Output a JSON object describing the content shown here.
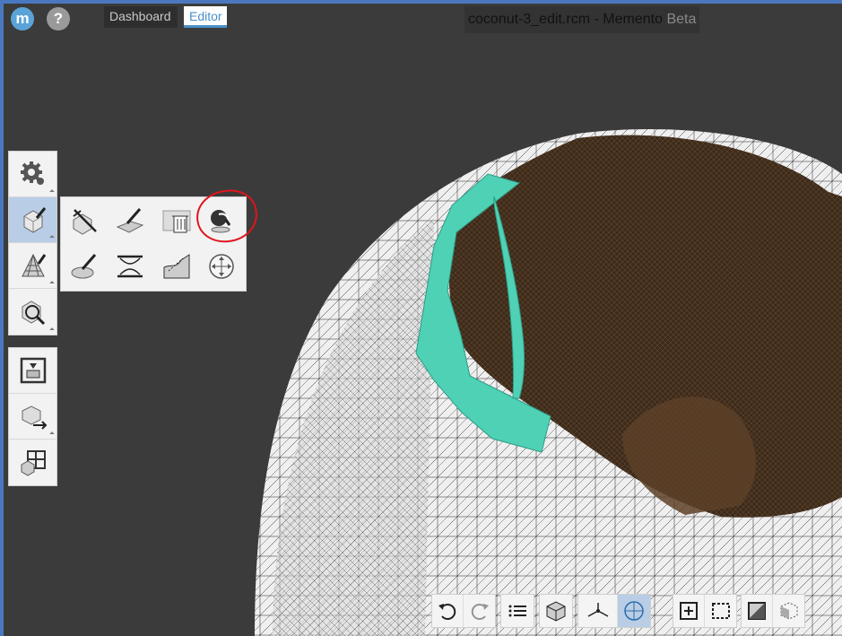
{
  "app": {
    "title_file": "coconut-3_edit.rcm - Memento",
    "title_suffix": "Beta",
    "logo_glyph": "m",
    "help_glyph": "?"
  },
  "tabs": [
    {
      "label": "Dashboard",
      "active": false
    },
    {
      "label": "Editor",
      "active": true
    }
  ],
  "left_toolbar": {
    "group1": [
      "settings-gear-icon",
      "edit-mesh-icon",
      "triangle-mesh-icon",
      "inspect-magnifier-icon"
    ],
    "group2": [
      "print-3d-icon",
      "export-cube-icon",
      "grid-layout-icon"
    ]
  },
  "flyout_tools": [
    "delete-selection-icon",
    "paint-surface-icon",
    "trash-mesh-icon",
    "fill-hole-icon",
    "smooth-brush-icon",
    "bridge-icon",
    "surface-cut-icon",
    "move-transform-icon"
  ],
  "bottom_toolbar": {
    "undo_redo": [
      "undo-icon",
      "redo-icon"
    ],
    "list": [
      "list-icon"
    ],
    "cube": [
      "cube-view-icon"
    ],
    "axes": [
      "axes-icon",
      "target-icon"
    ],
    "selection": [
      "add-select-icon",
      "marquee-select-icon"
    ],
    "display": [
      "clip-plane-icon",
      "xray-icon"
    ]
  },
  "colors": {
    "accent": "#4a90c8",
    "highlight_fill": "#4fd1b5",
    "annotation": "#e0151b",
    "background": "#3b3b3b"
  }
}
